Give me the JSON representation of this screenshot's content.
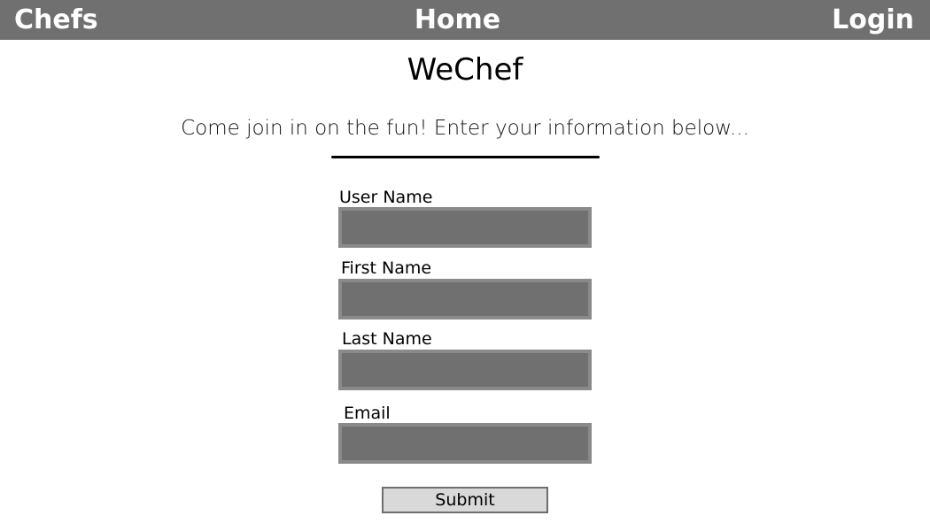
{
  "nav": {
    "left_label": "Chefs",
    "center_label": "Home",
    "right_label": "Login"
  },
  "colors": {
    "nav_background": "#707070",
    "input_background": "#707070",
    "input_border": "#8a8a8a",
    "button_background": "#d9d9d9"
  },
  "main": {
    "title": "WeChef",
    "tagline": "Come join in on the fun!  Enter your information below..."
  },
  "form": {
    "fields": [
      {
        "label": "User Name",
        "value": "",
        "placeholder": ""
      },
      {
        "label": "First Name",
        "value": "",
        "placeholder": ""
      },
      {
        "label": "Last Name",
        "value": "",
        "placeholder": ""
      },
      {
        "label": "Email",
        "value": "",
        "placeholder": ""
      }
    ],
    "submit_label": "Submit"
  }
}
